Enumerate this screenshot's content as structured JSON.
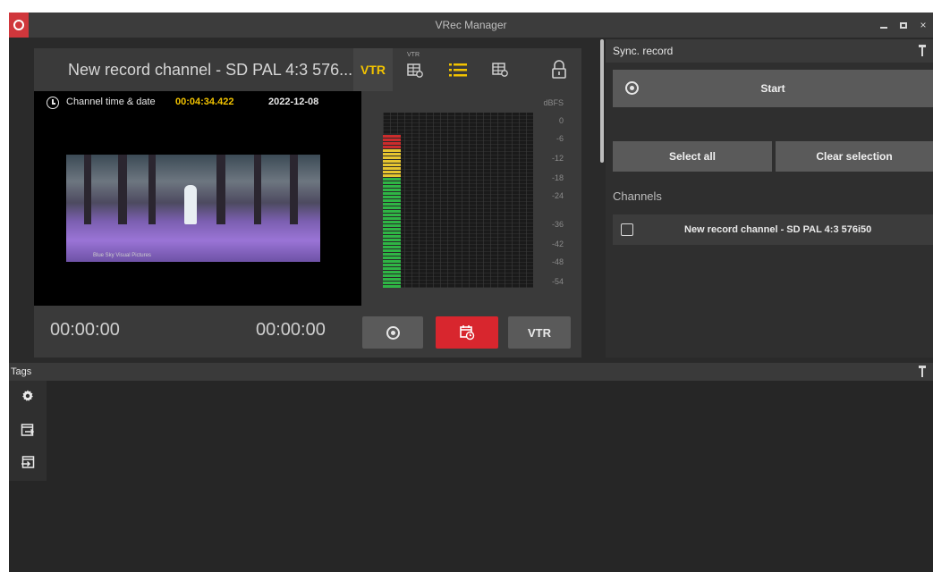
{
  "window": {
    "title": "VRec Manager",
    "app_icon": "record-app-icon",
    "controls": [
      "minimize-icon",
      "maximize-icon",
      "close-icon"
    ],
    "close_glyph": "×"
  },
  "channel": {
    "title": "New record channel - SD PAL 4:3 576...",
    "vtr_label": "VTR",
    "vtr_grid_sup": "VTR",
    "header_icons": [
      "vtr-grid-icon",
      "list-icon",
      "grid-icon",
      "lock-icon"
    ],
    "time_label": "Channel time & date",
    "time": "00:04:34.422",
    "date": "2022-12-08",
    "thumbnail_caption": "Blue Sky Visual Pictures",
    "meter_unit": "dBFS",
    "meter_scale": [
      "0",
      "-6",
      "-12",
      "-18",
      "-24",
      "-36",
      "-42",
      "-48",
      "-54"
    ],
    "meter_level_dbfs": -6,
    "timecode_in": "00:00:00",
    "timecode_out": "00:00:00",
    "footer_vtr_label": "VTR",
    "colors": {
      "accent": "#f2c300",
      "record_red": "#d8262e",
      "meter_green": "#2fb545",
      "meter_yellow": "#e6c530",
      "meter_red": "#cc2c2c"
    }
  },
  "sync": {
    "title": "Sync. record",
    "start_label": "Start",
    "select_all_label": "Select all",
    "clear_selection_label": "Clear selection",
    "channels_label": "Channels",
    "channels": [
      {
        "label": "New record channel - SD PAL 4:3 576i50",
        "checked": false
      }
    ]
  },
  "tags": {
    "title": "Tags",
    "tools": [
      "gear-icon",
      "export-icon",
      "import-icon"
    ]
  }
}
